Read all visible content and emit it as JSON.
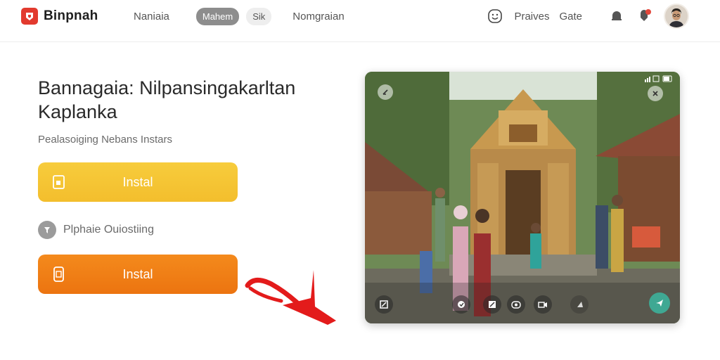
{
  "header": {
    "brand_name": "Binpnah",
    "nav": [
      {
        "label": "Naniaia"
      },
      {
        "label": "Mahem"
      },
      {
        "label": "Sik"
      },
      {
        "label": "Nomgraian"
      }
    ],
    "links": [
      "Praives",
      "Gate"
    ],
    "notification_icon": "bell-icon",
    "avatar_icon": "user-avatar"
  },
  "hero": {
    "title": "Bannagaia: Nilpansingakarltan Kaplanka",
    "subtitle": "Pealasoiging Nebans Instars",
    "primary_button_label": "Instal",
    "alt_option_label": "Plphaie Ouiostiing",
    "secondary_button_label": "Instal"
  },
  "colors": {
    "brand": "#e23a2e",
    "primary_button": "#f5c534",
    "secondary_button": "#f07f16",
    "annotation_arrow": "#e31b1b",
    "share_button": "#3fa893"
  },
  "media_panel": {
    "scene": "temple courtyard with people",
    "controls": [
      "expand-icon",
      "stamp-icon",
      "edit-icon",
      "camera-icon",
      "video-icon",
      "share-icon"
    ]
  }
}
